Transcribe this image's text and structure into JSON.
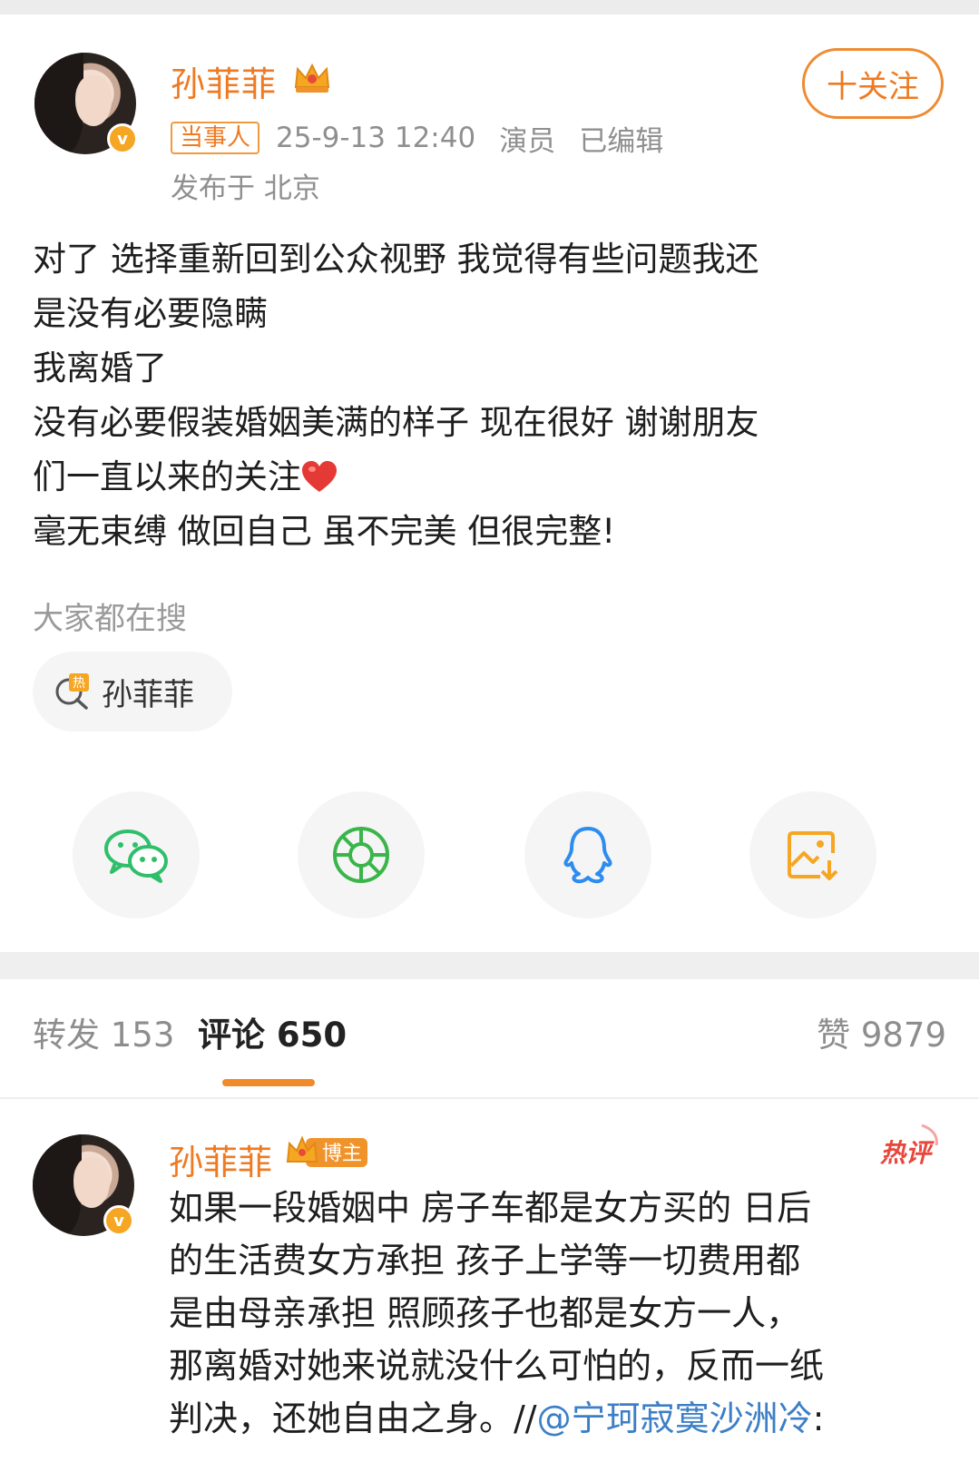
{
  "post": {
    "author": "孙菲菲",
    "follow_label": "十关注",
    "party_tag": "当事人",
    "timestamp": "25-9-13 12:40",
    "role": "演员",
    "edited": "已编辑",
    "location": "发布于 北京",
    "lines": [
      "对了 选择重新回到公众视野 我觉得有些问题我还",
      "是没有必要隐瞒",
      "我离婚了",
      "没有必要假装婚姻美满的样子 现在很好 谢谢朋友",
      "们一直以来的关注",
      "毫无束缚 做回自己 虽不完美 但很完整!"
    ]
  },
  "trending": {
    "label": "大家都在搜",
    "chip": "孙菲菲"
  },
  "share": {
    "icons": [
      "wechat-icon",
      "moments-icon",
      "qq-icon",
      "save-image-icon"
    ],
    "colors": {
      "wechat": "#2fbf6b",
      "moments": "#3ab54a",
      "qq": "#2d8cf0",
      "save": "#f5a623"
    }
  },
  "tabs": {
    "repost": "转发 153",
    "comments": "评论 650",
    "likes": "赞 9879"
  },
  "comment": {
    "author": "孙菲菲",
    "badge": "博主",
    "hot_tag": "热评",
    "lines": [
      "如果一段婚姻中 房子车都是女方买的 日后",
      "的生活费女方承担 孩子上学等一切费用都",
      "是由母亲承担 照顾孩子也都是女方一人，",
      "那离婚对她来说就没什么可怕的，反而一纸"
    ],
    "last_line_prefix": "判决，还她自由之身。//",
    "mention": "@宁珂寂寞沙洲冷",
    "last_line_suffix": ":"
  },
  "colors": {
    "accent": "#ee7a22",
    "link": "#3c7fc6",
    "muted": "#8f8f8f"
  }
}
